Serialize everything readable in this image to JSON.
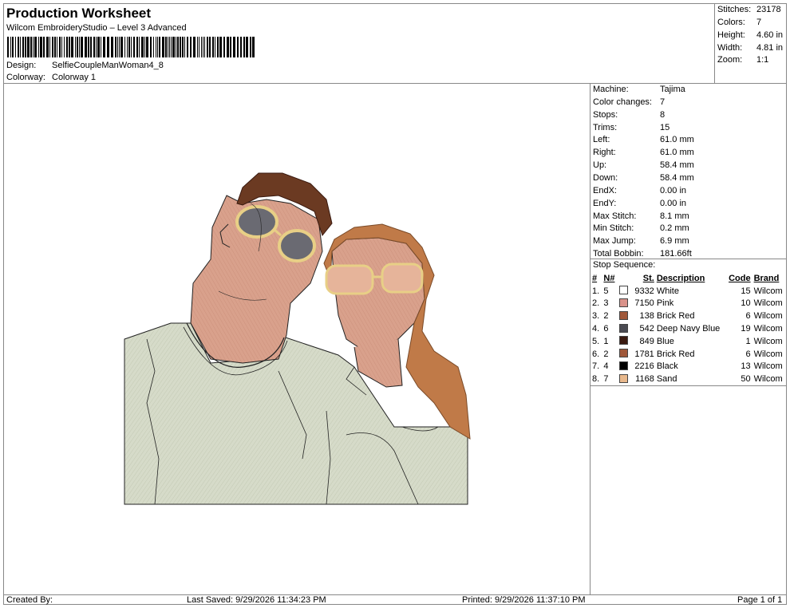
{
  "header": {
    "title": "Production Worksheet",
    "subtitle": "Wilcom EmbroideryStudio – Level 3 Advanced",
    "design_label": "Design:",
    "design_value": "SelfieCoupleManWoman4_8",
    "colorway_label": "Colorway:",
    "colorway_value": "Colorway 1"
  },
  "stats": [
    {
      "label": "Stitches:",
      "value": "23178"
    },
    {
      "label": "Colors:",
      "value": "7"
    },
    {
      "label": "Height:",
      "value": "4.60 in"
    },
    {
      "label": "Width:",
      "value": "4.81 in"
    },
    {
      "label": "Zoom:",
      "value": "1:1"
    }
  ],
  "machine": [
    {
      "label": "Machine:",
      "value": "Tajima"
    },
    {
      "label": "Color changes:",
      "value": "7"
    },
    {
      "label": "Stops:",
      "value": "8"
    },
    {
      "label": "Trims:",
      "value": "15"
    },
    {
      "label": "Left:",
      "value": "61.0 mm"
    },
    {
      "label": "Right:",
      "value": "61.0 mm"
    },
    {
      "label": "Up:",
      "value": "58.4 mm"
    },
    {
      "label": "Down:",
      "value": "58.4 mm"
    },
    {
      "label": "EndX:",
      "value": "0.00 in"
    },
    {
      "label": "EndY:",
      "value": "0.00 in"
    },
    {
      "label": "Max Stitch:",
      "value": "8.1 mm"
    },
    {
      "label": "Min Stitch:",
      "value": "0.2 mm"
    },
    {
      "label": "Max Jump:",
      "value": "6.9 mm"
    },
    {
      "label": "Total Bobbin:",
      "value": "181.66ft"
    }
  ],
  "sequence": {
    "title": "Stop Sequence:",
    "headers": {
      "num": "#",
      "n": "N#",
      "st": "St.",
      "desc": "Description",
      "code": "Code",
      "brand": "Brand"
    },
    "rows": [
      {
        "num": "1.",
        "n": "5",
        "st": "9332",
        "desc": "White",
        "code": "15",
        "brand": "Wilcom",
        "color": "#ffffff"
      },
      {
        "num": "2.",
        "n": "3",
        "st": "7150",
        "desc": "Pink",
        "code": "10",
        "brand": "Wilcom",
        "color": "#d9928a"
      },
      {
        "num": "3.",
        "n": "2",
        "st": "138",
        "desc": "Brick Red",
        "code": "6",
        "brand": "Wilcom",
        "color": "#a0583a"
      },
      {
        "num": "4.",
        "n": "6",
        "st": "542",
        "desc": "Deep Navy Blue",
        "code": "19",
        "brand": "Wilcom",
        "color": "#4a4a52"
      },
      {
        "num": "5.",
        "n": "1",
        "st": "849",
        "desc": "Blue",
        "code": "1",
        "brand": "Wilcom",
        "color": "#3a1a10"
      },
      {
        "num": "6.",
        "n": "2",
        "st": "1781",
        "desc": "Brick Red",
        "code": "6",
        "brand": "Wilcom",
        "color": "#a0583a"
      },
      {
        "num": "7.",
        "n": "4",
        "st": "2216",
        "desc": "Black",
        "code": "13",
        "brand": "Wilcom",
        "color": "#000000"
      },
      {
        "num": "8.",
        "n": "7",
        "st": "1168",
        "desc": "Sand",
        "code": "50",
        "brand": "Wilcom",
        "color": "#e8b88c"
      }
    ]
  },
  "footer": {
    "created": "Created By:",
    "saved": "Last Saved: 9/29/2026 11:34:23 PM",
    "printed": "Printed: 9/29/2026 11:37:10 PM",
    "page": "Page 1 of 1"
  },
  "design_colors": {
    "shirt": "#d4d9c7",
    "skin": "#d8a08a",
    "man_hair": "#6b3a22",
    "woman_hair": "#c07a48",
    "glasses_frame": "#e8cf86",
    "lens": "#6a6a72"
  }
}
